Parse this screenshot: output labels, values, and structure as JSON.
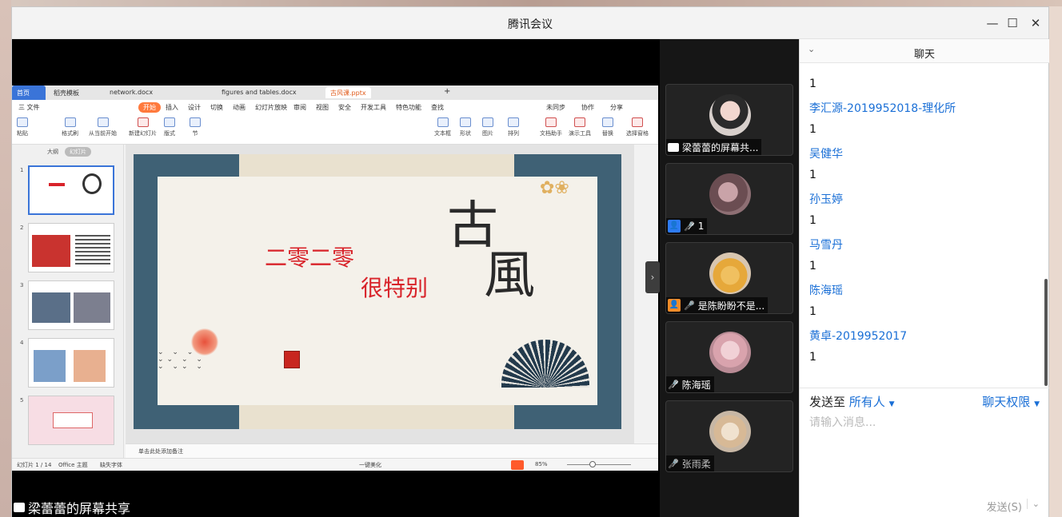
{
  "window": {
    "title": "腾讯会议",
    "controls": [
      "—",
      "☐",
      "✕"
    ]
  },
  "share": {
    "label": "梁蕾蕾的屏幕共享",
    "wps": {
      "tabs": [
        "首页",
        "稻壳模板",
        "network.docx",
        "figures and tables.docx",
        "古风课.pptx"
      ],
      "menu": [
        "三 文件",
        "开始",
        "插入",
        "设计",
        "切换",
        "动画",
        "幻灯片放映",
        "审阅",
        "视图",
        "安全",
        "开发工具",
        "特色功能",
        "查找",
        "未同步",
        "协作",
        "分享"
      ],
      "ribbon": [
        "粘贴",
        "格式刷",
        "从当前开始",
        "新建幻灯片",
        "版式",
        "节",
        "文本框",
        "形状",
        "图片",
        "排列",
        "文档助手",
        "演示工具",
        "替换",
        "选择窗格"
      ],
      "panel_tabs": [
        "大纲",
        "幻灯片"
      ],
      "slide_numbers": [
        "1",
        "2",
        "3",
        "4",
        "5"
      ],
      "slide": {
        "line1": "二零二零",
        "line2": "很特别",
        "calligraphy_top": "古",
        "calligraphy_bottom": "風"
      },
      "notes": "单击此处添加备注",
      "status": {
        "slide_count": "幻灯片 1 / 14",
        "theme": "Office 主题",
        "font": "缺失字体",
        "beautify": "一键美化",
        "zoom": "85%"
      }
    }
  },
  "participants": [
    {
      "name": "梁蕾蕾的屏幕共...",
      "badge": "screen"
    },
    {
      "name": "1",
      "badge": "user-muted"
    },
    {
      "name": "是陈盼盼不是...",
      "badge": "user-mic"
    },
    {
      "name": "陈海瑶",
      "badge": "muted"
    },
    {
      "name": "张雨柔",
      "badge": "muted"
    }
  ],
  "chat": {
    "title": "聊天",
    "messages": [
      {
        "name": "",
        "text": "1"
      },
      {
        "name": "李汇源-2019952018-理化所",
        "text": "1"
      },
      {
        "name": "吴健华",
        "text": "1"
      },
      {
        "name": "孙玉婷",
        "text": "1"
      },
      {
        "name": "马雪丹",
        "text": "1"
      },
      {
        "name": "陈海瑶",
        "text": "1"
      },
      {
        "name": "黄卓-2019952017",
        "text": "1"
      }
    ],
    "send_to_label": "发送至",
    "send_to_value": "所有人",
    "permission": "聊天权限",
    "placeholder": "请输入消息...",
    "send_button": "发送(S)"
  },
  "colors": {
    "accent": "#1a6fd6",
    "slide_red": "#d8232a",
    "wps_orange": "#ff7a3d"
  }
}
